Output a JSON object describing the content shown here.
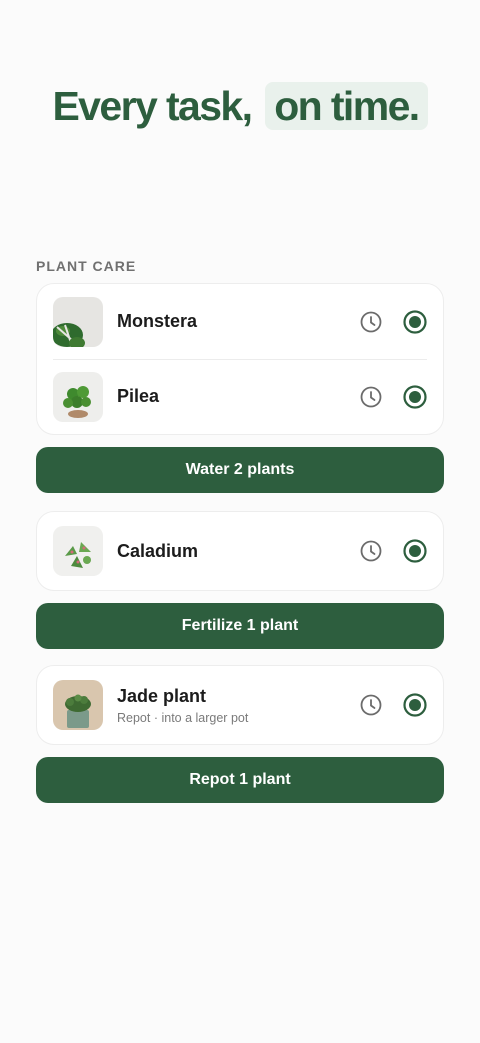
{
  "headline": {
    "part1": "Every task,",
    "part2": "on time."
  },
  "section": {
    "label": "PLANT CARE"
  },
  "groups": [
    {
      "plants": [
        {
          "name": "Monstera",
          "subtitle": ""
        },
        {
          "name": "Pilea",
          "subtitle": ""
        }
      ],
      "button_label": "Water 2 plants"
    },
    {
      "plants": [
        {
          "name": "Caladium",
          "subtitle": ""
        }
      ],
      "button_label": "Fertilize 1 plant"
    },
    {
      "plants": [
        {
          "name": "Jade plant",
          "subtitle": "Repot · into a larger pot"
        }
      ],
      "button_label": "Repot 1 plant"
    }
  ],
  "icons": {
    "snooze": "clock-icon",
    "complete": "radio-check-icon"
  },
  "colors": {
    "brand": "#2d5e3e",
    "highlight": "#e9f1ec",
    "background": "#fbfbfb"
  }
}
